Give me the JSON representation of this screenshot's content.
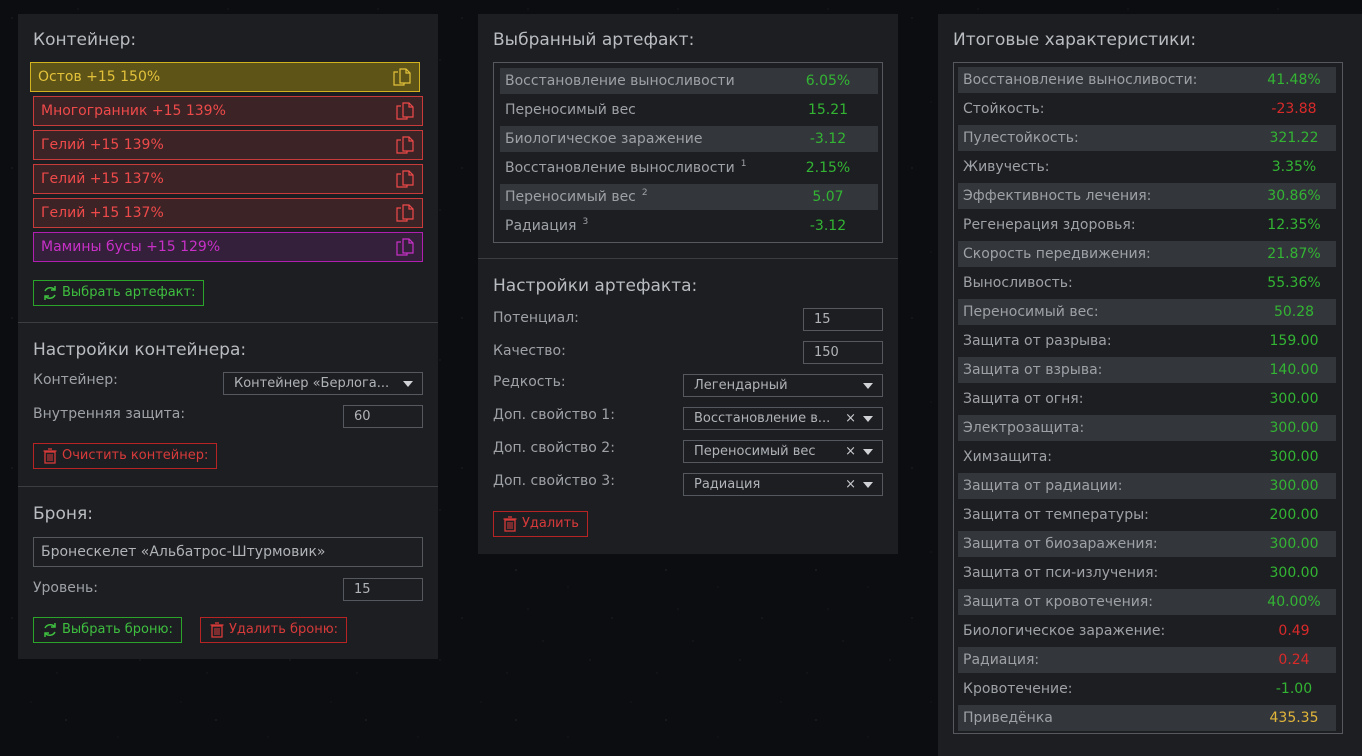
{
  "container_panel": {
    "title": "Контейнер:",
    "items": [
      {
        "label": "Остов +15 150%",
        "rarity": "gold"
      },
      {
        "label": "Многогранник +15 139%",
        "rarity": "red"
      },
      {
        "label": "Гелий +15 139%",
        "rarity": "red"
      },
      {
        "label": "Гелий +15 137%",
        "rarity": "red"
      },
      {
        "label": "Гелий +15 137%",
        "rarity": "red"
      },
      {
        "label": "Мамины бусы +15 129%",
        "rarity": "purple"
      }
    ],
    "select_artifact_label": "Выбрать артефакт:",
    "settings": {
      "title": "Настройки контейнера:",
      "container_label": "Контейнер:",
      "container_value": "Контейнер «Берлога...",
      "inner_protection_label": "Внутренняя защита:",
      "inner_protection_value": "60",
      "clear_label": "Очистить контейнер:"
    },
    "armor": {
      "title": "Броня:",
      "name_value": "Бронескелет «Альбатрос-Штурмовик»",
      "level_label": "Уровень:",
      "level_value": "15",
      "select_label": "Выбрать броню:",
      "delete_label": "Удалить броню:"
    }
  },
  "artifact_panel": {
    "title": "Выбранный артефакт:",
    "stats": [
      {
        "name": "Восстановление выносливости",
        "sup": "",
        "value": "6.05%",
        "color": "green"
      },
      {
        "name": "Переносимый вес",
        "sup": "",
        "value": "15.21",
        "color": "green"
      },
      {
        "name": "Биологическое заражение",
        "sup": "",
        "value": "-3.12",
        "color": "green"
      },
      {
        "name": "Восстановление выносливости",
        "sup": "1",
        "value": "2.15%",
        "color": "green"
      },
      {
        "name": "Переносимый вес",
        "sup": "2",
        "value": "5.07",
        "color": "green"
      },
      {
        "name": "Радиация",
        "sup": "3",
        "value": "-3.12",
        "color": "green"
      }
    ],
    "settings": {
      "title": "Настройки артефакта:",
      "potential_label": "Потенциал:",
      "potential_value": "15",
      "quality_label": "Качество:",
      "quality_value": "150",
      "rarity_label": "Редкость:",
      "rarity_value": "Легендарный",
      "prop1_label": "Доп. свойство 1:",
      "prop1_value": "Восстановление в...",
      "prop2_label": "Доп. свойство 2:",
      "prop2_value": "Переносимый вес",
      "prop3_label": "Доп. свойство 3:",
      "prop3_value": "Радиация",
      "clear_glyph": "×",
      "delete_label": "Удалить"
    }
  },
  "totals_panel": {
    "title": "Итоговые характеристики:",
    "stats": [
      {
        "name": "Восстановление выносливости:",
        "value": "41.48%",
        "color": "green"
      },
      {
        "name": "Стойкость:",
        "value": "-23.88",
        "color": "red"
      },
      {
        "name": "Пулестойкость:",
        "value": "321.22",
        "color": "green"
      },
      {
        "name": "Живучесть:",
        "value": "3.35%",
        "color": "green"
      },
      {
        "name": "Эффективность лечения:",
        "value": "30.86%",
        "color": "green"
      },
      {
        "name": "Регенерация здоровья:",
        "value": "12.35%",
        "color": "green"
      },
      {
        "name": "Скорость передвижения:",
        "value": "21.87%",
        "color": "green"
      },
      {
        "name": "Выносливость:",
        "value": "55.36%",
        "color": "green"
      },
      {
        "name": "Переносимый вес:",
        "value": "50.28",
        "color": "green"
      },
      {
        "name": "Защита от разрыва:",
        "value": "159.00",
        "color": "green"
      },
      {
        "name": "Защита от взрыва:",
        "value": "140.00",
        "color": "green"
      },
      {
        "name": "Защита от огня:",
        "value": "300.00",
        "color": "green"
      },
      {
        "name": "Электрозащита:",
        "value": "300.00",
        "color": "green"
      },
      {
        "name": "Химзащита:",
        "value": "300.00",
        "color": "green"
      },
      {
        "name": "Защита от радиации:",
        "value": "300.00",
        "color": "green"
      },
      {
        "name": "Защита от температуры:",
        "value": "200.00",
        "color": "green"
      },
      {
        "name": "Защита от биозаражения:",
        "value": "300.00",
        "color": "green"
      },
      {
        "name": "Защита от пси-излучения:",
        "value": "300.00",
        "color": "green"
      },
      {
        "name": "Защита от кровотечения:",
        "value": "40.00%",
        "color": "green"
      },
      {
        "name": "Биологическое заражение:",
        "value": "0.49",
        "color": "red"
      },
      {
        "name": "Радиация:",
        "value": "0.24",
        "color": "red"
      },
      {
        "name": "Кровотечение:",
        "value": "-1.00",
        "color": "green"
      },
      {
        "name": "Приведёнка",
        "value": "435.35",
        "color": "gold"
      }
    ]
  },
  "colors": {
    "gold_border": "#d2b21e",
    "gold_text": "#e3c23a",
    "gold_bg": "#5e5418",
    "red_border": "#c93a3a",
    "red_text": "#ef4a4a",
    "red_bg": "#3b2326",
    "purple_border": "#b01fb0",
    "purple_text": "#c830c8",
    "purple_bg": "#34203a"
  },
  "icons": {
    "copy": "copy-icon",
    "refresh": "refresh-icon",
    "trash": "trash-icon",
    "caret": "chevron-down-icon"
  }
}
